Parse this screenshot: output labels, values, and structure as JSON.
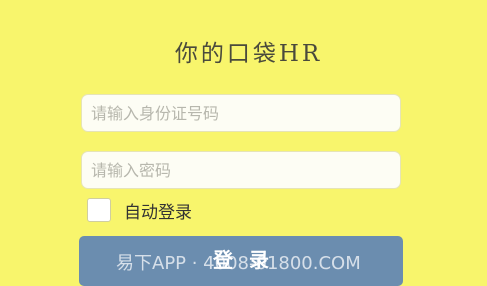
{
  "app": {
    "title": "你的口袋HR"
  },
  "form": {
    "id_placeholder": "请输入身份证号码",
    "id_value": "",
    "password_placeholder": "请输入密码",
    "password_value": "",
    "remember_label": "自动登录",
    "remember_checked": false,
    "login_label": "登录"
  },
  "watermark": {
    "text": "易下APP · 4008-01800.COM"
  },
  "colors": {
    "background": "#f8f56c",
    "button": "#6b8daf",
    "field": "#fdfdf4"
  }
}
